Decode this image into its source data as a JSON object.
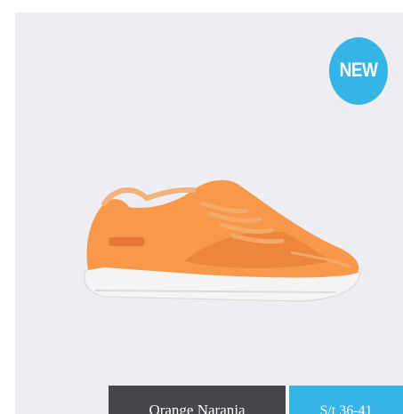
{
  "product": {
    "badge": "NEW",
    "image_icon": "shoe-sneaker-icon",
    "color_name": "Orange Naranja",
    "sizes": "S/t 36-41"
  },
  "colors": {
    "card_bg": "#eeedf1",
    "badge": "#35b4e6",
    "color_bar": "#464549",
    "size_bar": "#35b4e6",
    "shoe_upper": "#f7984a",
    "sole": "#f4f4f2"
  }
}
